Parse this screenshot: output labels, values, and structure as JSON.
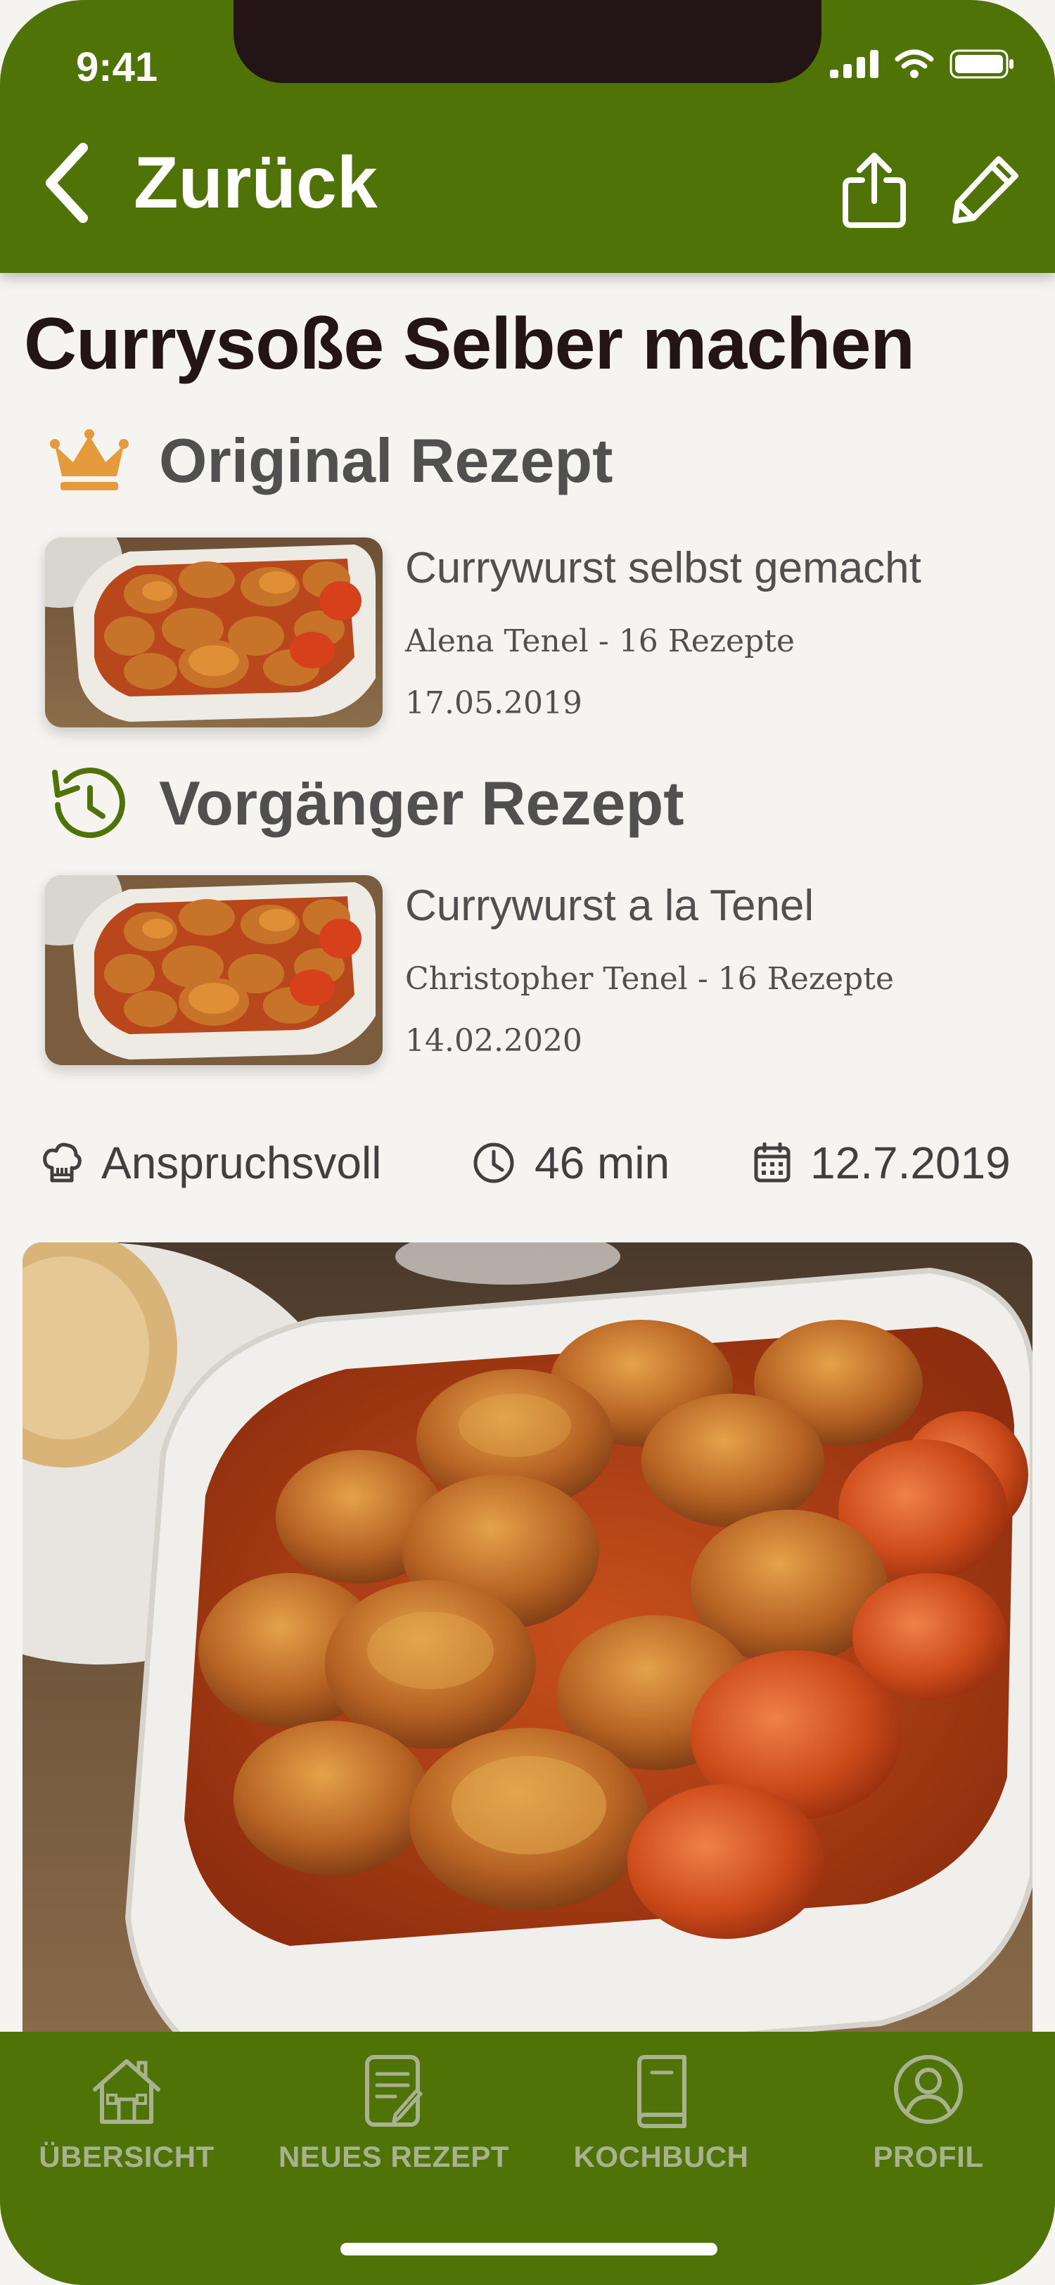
{
  "status_bar": {
    "time": "9:41"
  },
  "header": {
    "back_label": "Zurück",
    "icons": [
      "share-icon",
      "pencil-icon"
    ]
  },
  "recipe": {
    "title": "Currysoße Selber machen"
  },
  "original": {
    "section_title": "Original Rezept",
    "icon": "crown-icon",
    "card": {
      "title": "Currywurst selbst gemacht",
      "author": "Alena Tenel - 16 Rezepte",
      "date": "17.05.2019"
    }
  },
  "predecessor": {
    "section_title": "Vorgänger Rezept",
    "icon": "history-icon",
    "card": {
      "title": "Currywurst a la Tenel",
      "author": "Christopher Tenel - 16 Rezepte",
      "date": "14.02.2020"
    }
  },
  "meta": {
    "difficulty": "Anspruchsvoll",
    "duration": "46 min",
    "date": "12.7.2019"
  },
  "tabbar": {
    "items": [
      {
        "label": "ÜBERSICHT",
        "icon": "house-icon"
      },
      {
        "label": "NEUES REZEPT",
        "icon": "new-recipe-icon"
      },
      {
        "label": "KOCHBUCH",
        "icon": "book-icon"
      },
      {
        "label": "PROFIL",
        "icon": "profile-icon"
      }
    ]
  },
  "colors": {
    "brand_green": "#4f7307",
    "background": "#f5f4f1",
    "title_dark": "#231515",
    "crown_orange": "#e59a3c"
  }
}
